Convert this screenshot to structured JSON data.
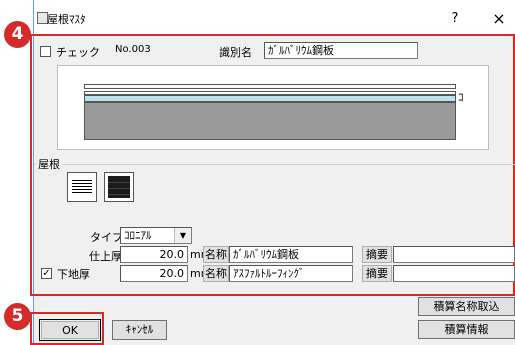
{
  "window": {
    "title": "屋根ﾏｽﾀ",
    "help_label": "?",
    "close_label": "×"
  },
  "badges": {
    "step4": "4",
    "step5": "5"
  },
  "header": {
    "check_label": "チェック",
    "number": "No.003",
    "id_name_label": "識別名",
    "id_name_value": "ｶﾞﾙﾊﾞﾘｳﾑ鋼板"
  },
  "preview": {
    "marker": "ｺ"
  },
  "roof": {
    "group_label": "屋根",
    "type_label": "タイプ",
    "type_value": "ｺﾛﾆｱﾙ",
    "finish_label": "仕上厚",
    "finish_value": "20.0",
    "base_label": "下地厚",
    "base_checked": "✓",
    "base_value": "20.0",
    "unit": "mm",
    "name_button": "名称",
    "finish_name": "ｶﾞﾙﾊﾞﾘｳﾑ鋼板",
    "base_name": "ｱｽﾌｧﾙﾄﾙｰﾌｨﾝｸﾞ",
    "summary_button": "摘要",
    "finish_summary": "",
    "base_summary": ""
  },
  "footer": {
    "ok": "OK",
    "cancel": "ｷｬﾝｾﾙ",
    "estimate_name_import": "積算名称取込",
    "estimate_info": "積算情報"
  },
  "colors": {
    "accent_red": "#d32a2a",
    "layer_gray": "#9a9a9a",
    "layer_cyan": "#bfe3ec"
  }
}
